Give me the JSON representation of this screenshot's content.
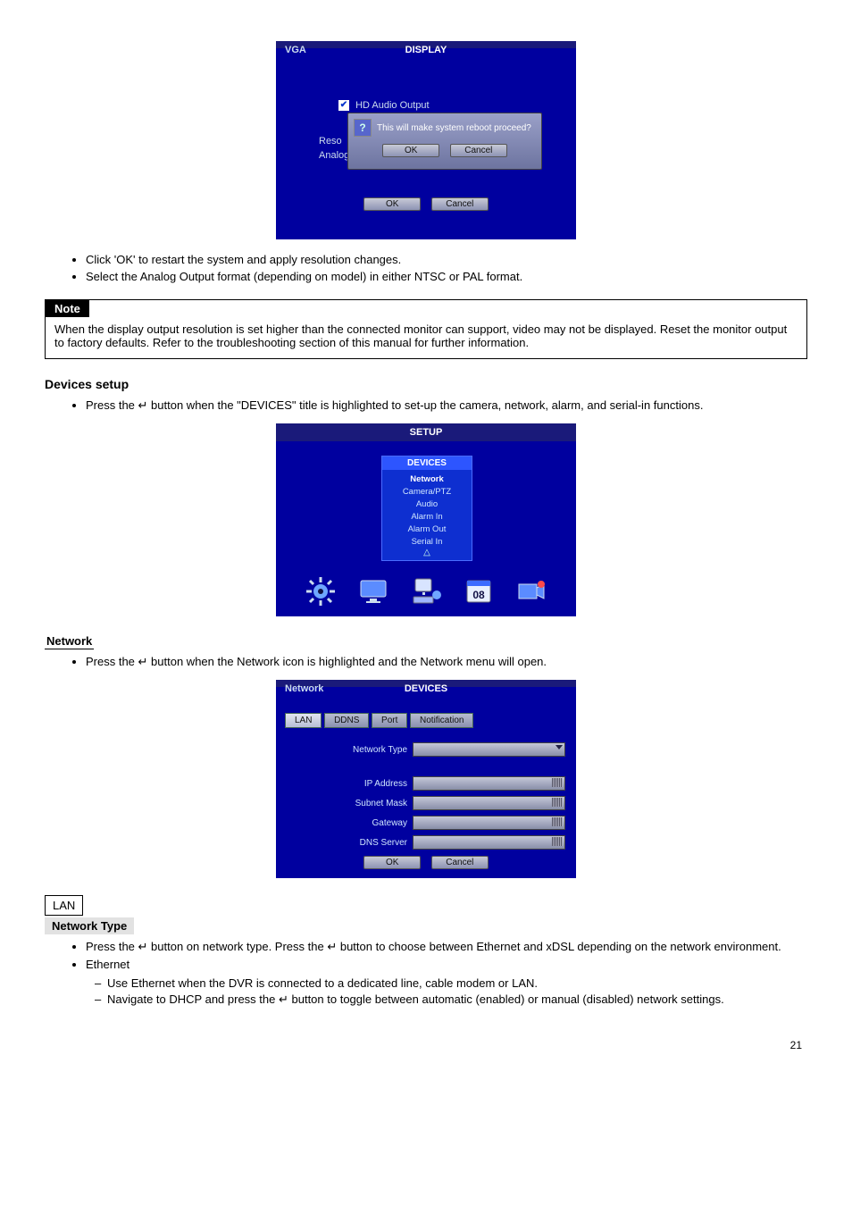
{
  "img1": {
    "title_left": "VGA",
    "title_center": "DISPLAY",
    "checkbox_label": "HD Audio Output",
    "checkbox_glyph": "✔",
    "side_lines": [
      "Reso",
      "Analog"
    ],
    "dialog_q": "?",
    "dialog_text": "This will make system reboot proceed?",
    "ok": "OK",
    "cancel": "Cancel"
  },
  "after_img1": {
    "b1": "Click 'OK' to restart the system and apply resolution changes.",
    "b2": "Select the Analog Output format (depending on model) in either NTSC or PAL format."
  },
  "note": {
    "head": "Note",
    "body": "When the display output resolution is set higher than the connected monitor can support, video may not be displayed. Reset the monitor output to factory defaults. Refer to the troubleshooting section of this manual for further information."
  },
  "devices_heading": "Devices setup",
  "devices_bullet": "Press the ",
  "devices_bullet_cont": " button when the \"DEVICES\" title is highlighted to set-up the camera, network, alarm, and serial-in functions.",
  "enter_glyph": "↵",
  "img2": {
    "title": "SETUP",
    "panel_head": "DEVICES",
    "items": [
      "Network",
      "Camera/PTZ",
      "Audio",
      "Alarm In",
      "Alarm Out",
      "Serial In"
    ],
    "tri": "△"
  },
  "network_heading": "Network",
  "network_bullet": "Press the ",
  "network_bullet_cont": " button when the Network icon is highlighted and the Network menu will open.",
  "img3": {
    "title_left": "Network",
    "title_center": "DEVICES",
    "tabs": [
      "LAN",
      "DDNS",
      "Port",
      "Notification"
    ],
    "label_type": "Network Type",
    "dd_value": "",
    "label_ip": "IP Address",
    "label_sub": "Subnet Mask",
    "label_gw": "Gateway",
    "label_dns": "DNS Server",
    "ok": "OK",
    "cancel": "Cancel"
  },
  "lan_box": "LAN",
  "nettype_shade": "Network Type",
  "lan_b1a": "Press the ",
  "lan_b1b": " button on network type. Press the ",
  "lan_b1c": " button to choose between Ethernet and xDSL depending on the network environment.",
  "lan_b2": "Ethernet",
  "dash1": "Use Ethernet when the DVR is connected to a dedicated line, cable modem or LAN.",
  "dash2a": "Navigate to DHCP and press the ",
  "dash2b": " button to toggle between automatic (enabled) or manual (disabled) network settings.",
  "page_num": "21"
}
